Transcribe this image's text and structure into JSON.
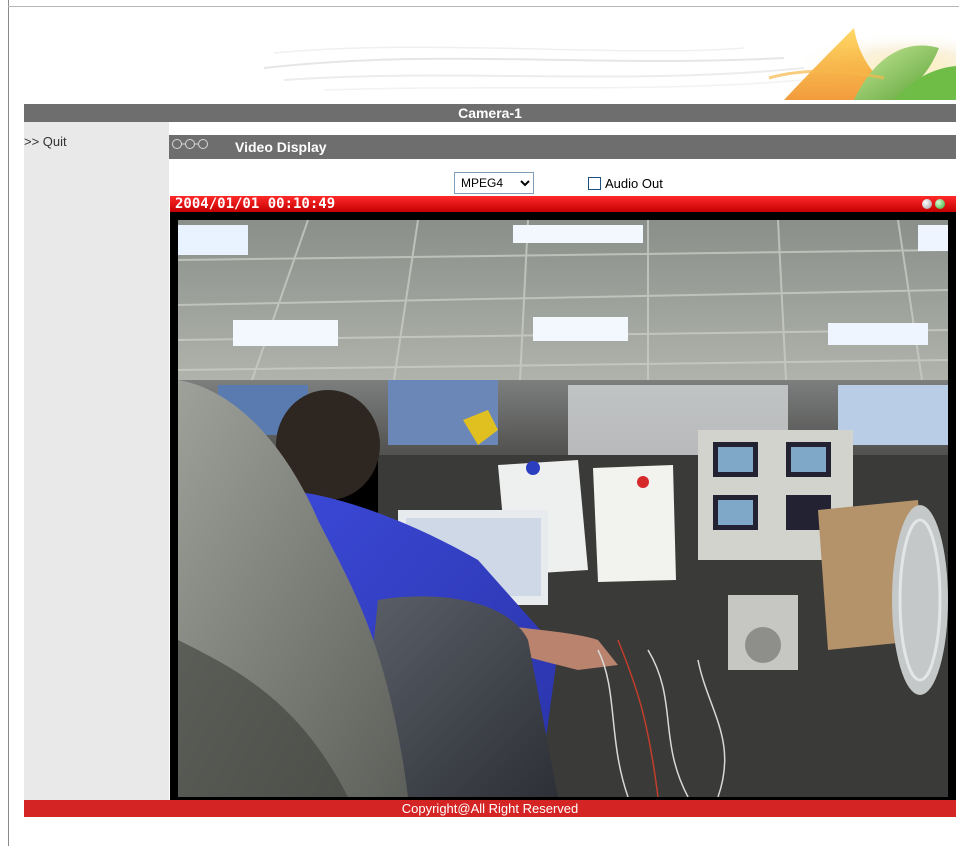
{
  "page": {
    "title": "Camera-1"
  },
  "sidebar": {
    "quit_label": ">> Quit"
  },
  "section": {
    "title": "Video Display",
    "icon": "chain-links-icon"
  },
  "controls": {
    "codec_selected": "MPEG4",
    "codec_options": [
      "MPEG4"
    ],
    "audio_label": "Audio Out",
    "audio_checked": false
  },
  "video": {
    "timestamp": "2004/01/01 00:10:49",
    "scene": "office-camera-feed"
  },
  "footer": {
    "copyright": "Copyright@All Right Reserved"
  },
  "colors": {
    "title_bar": "#6e6e6e",
    "sidebar_bg": "#e9e9e9",
    "video_bar": "#e00000",
    "footer_bar": "#d42424"
  }
}
